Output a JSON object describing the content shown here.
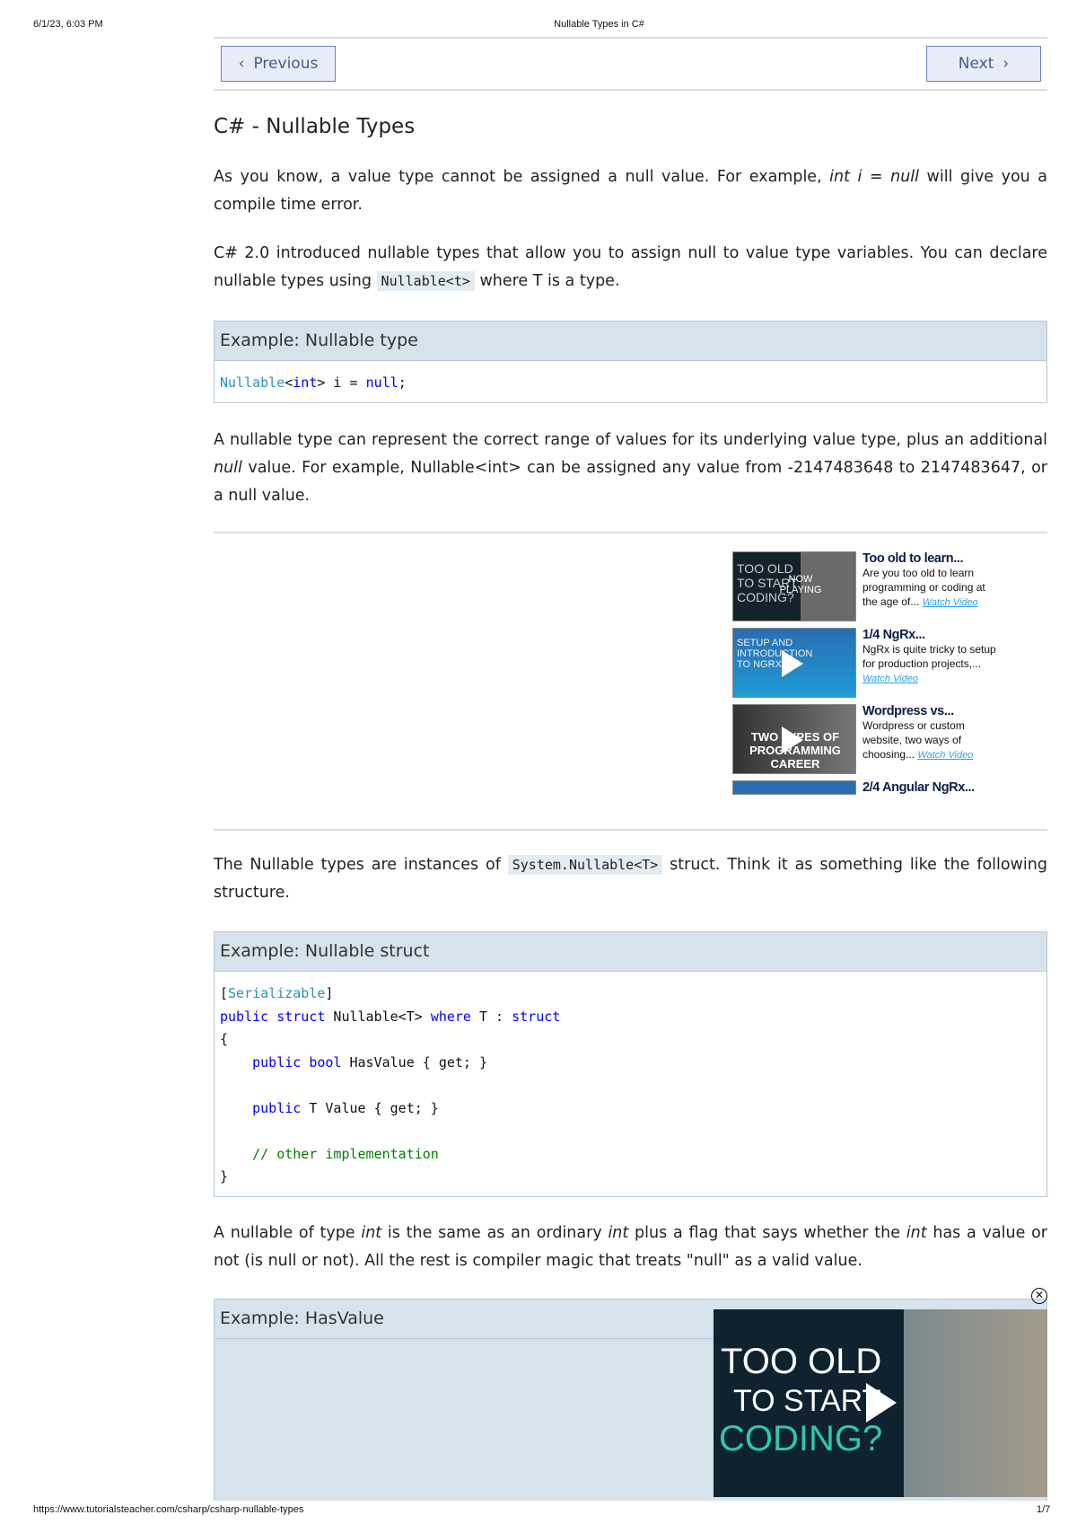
{
  "print_header": {
    "date": "6/1/23, 6:03 PM",
    "title": "Nullable Types in C#"
  },
  "nav": {
    "previous": "Previous",
    "next": "Next"
  },
  "page_title": "C# - Nullable Types",
  "paragraphs": {
    "p1a": "As you know, a value type cannot be assigned a null value. For example, ",
    "p1code": "int i = null",
    "p1b": " will give you a compile time error.",
    "p2a": "C# 2.0 introduced nullable types that allow you to assign null to value type variables. You can declare nullable types using ",
    "p2code": "Nullable<t>",
    "p2b": " where T is a type.",
    "p3a": "A nullable type can represent the correct range of values for its underlying value type, plus an additional ",
    "p3em": "null",
    "p3b": " value. For example, Nullable<int> can be assigned any value from -2147483648 to 2147483647, or a null value.",
    "p4a": "The Nullable types are instances of ",
    "p4code": "System.Nullable<T>",
    "p4b": " struct. Think it as something like the following structure.",
    "p5a": "A nullable of type ",
    "p5em1": "int",
    "p5b": " is the same as an ordinary ",
    "p5em2": "int",
    "p5c": " plus a flag that says whether the ",
    "p5em3": "int",
    "p5d": " has a value or not (is null or not). All the rest is compiler magic that treats \"null\" as a valid value."
  },
  "examples": [
    {
      "title": "Example: Nullable type"
    },
    {
      "title": "Example: Nullable struct"
    },
    {
      "title": "Example: HasValue"
    }
  ],
  "videos": [
    {
      "title": "Too old to learn...",
      "desc": "Are you too old to learn programming or coding at the age of...",
      "link": "Watch Video",
      "thumb": "TOO OLD TO START CODING?",
      "overlay": "NOW PLAYING"
    },
    {
      "title": "1/4 NgRx...",
      "desc": "NgRx is quite tricky to setup for production projects,...",
      "link": "Watch Video",
      "thumb": "SETUP AND INTRODUCTION TO NGRX"
    },
    {
      "title": "Wordpress vs...",
      "desc": "Wordpress or custom website, two ways of choosing...",
      "link": "Watch Video",
      "thumb": "TWO TYPES OF PROGRAMMING CAREER"
    },
    {
      "title": "2/4 Angular NgRx..."
    }
  ],
  "ad_video": {
    "line1": "TOO OLD",
    "line2": "TO START",
    "line3": "CODING?"
  },
  "print_footer": {
    "url": "https://www.tutorialsteacher.com/csharp/csharp-nullable-types",
    "page": "1/7"
  },
  "colors": {
    "keyword": "#0000ff",
    "type": "#2b91af",
    "comment": "#008000",
    "box_header": "#d6e2ec"
  }
}
